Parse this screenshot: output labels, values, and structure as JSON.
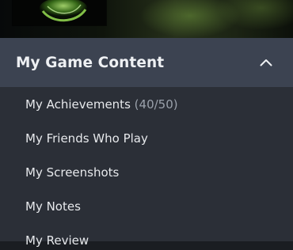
{
  "section": {
    "title": "My Game Content",
    "collapse_icon": "chevron-up-icon"
  },
  "thumbnail_icon": "game-art-thumbnail",
  "items": [
    {
      "label": "My Achievements",
      "count": "(40/50)"
    },
    {
      "label": "My Friends Who Play"
    },
    {
      "label": "My Screenshots"
    },
    {
      "label": "My Notes"
    },
    {
      "label": "My Review"
    }
  ]
}
